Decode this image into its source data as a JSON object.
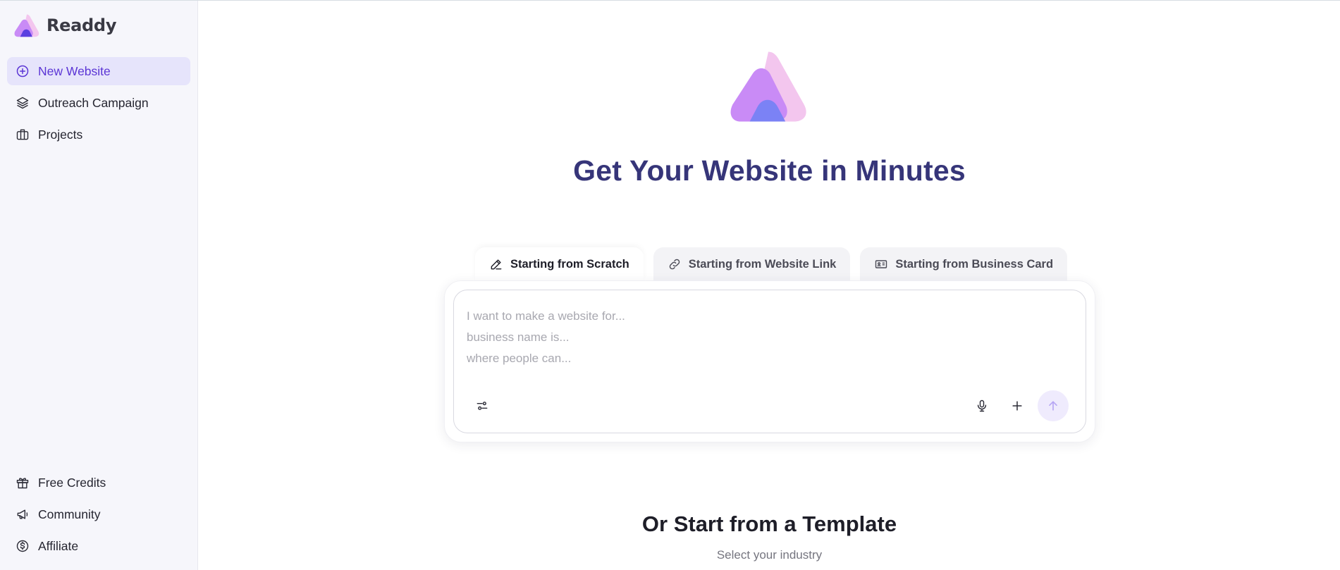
{
  "brand": {
    "name": "Readdy"
  },
  "sidebar": {
    "top_items": [
      {
        "label": "New Website",
        "icon": "plus-circle-icon",
        "active": true
      },
      {
        "label": "Outreach Campaign",
        "icon": "layers-icon",
        "active": false
      },
      {
        "label": "Projects",
        "icon": "briefcase-icon",
        "active": false
      }
    ],
    "bottom_items": [
      {
        "label": "Free Credits",
        "icon": "gift-icon"
      },
      {
        "label": "Community",
        "icon": "megaphone-icon"
      },
      {
        "label": "Affiliate",
        "icon": "dollar-circle-icon"
      }
    ]
  },
  "main": {
    "headline": "Get Your Website in Minutes",
    "tabs": [
      {
        "label": "Starting from Scratch",
        "icon": "pencil-icon",
        "active": true
      },
      {
        "label": "Starting from Website Link",
        "icon": "link-icon",
        "active": false
      },
      {
        "label": "Starting from Business Card",
        "icon": "id-card-icon",
        "active": false
      }
    ],
    "composer": {
      "value": "",
      "placeholder": "I want to make a website for...\nbusiness name is...\nwhere people can..."
    },
    "template_title": "Or Start from a Template",
    "template_subtitle": "Select your industry"
  },
  "colors": {
    "accent": "#5b35d5",
    "headline": "#363579",
    "active_nav_bg": "#e6e4fb",
    "logo_pink": "#f3c6ee",
    "logo_purple": "#c98bf6",
    "logo_blue": "#7b82f5"
  }
}
